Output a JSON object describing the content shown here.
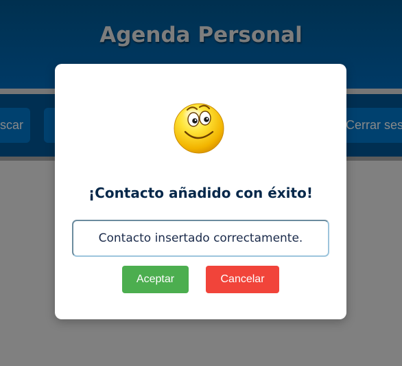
{
  "app": {
    "title": "Agenda Personal",
    "nav": {
      "left_button_label": "Buscar",
      "right_button_label": "Cerrar sesión"
    }
  },
  "dialog": {
    "icon": "smiley-face-icon",
    "title": "¡Contacto añadido con éxito!",
    "message_value": "Contacto insertado correctamente.",
    "accept_label": "Aceptar",
    "cancel_label": "Cancelar"
  },
  "colors": {
    "header": "#003a66",
    "nav": "#002f52",
    "overlay_background": "#808080",
    "accept": "#4cae4f",
    "cancel": "#f1443a",
    "dialog_title": "#06284a"
  }
}
